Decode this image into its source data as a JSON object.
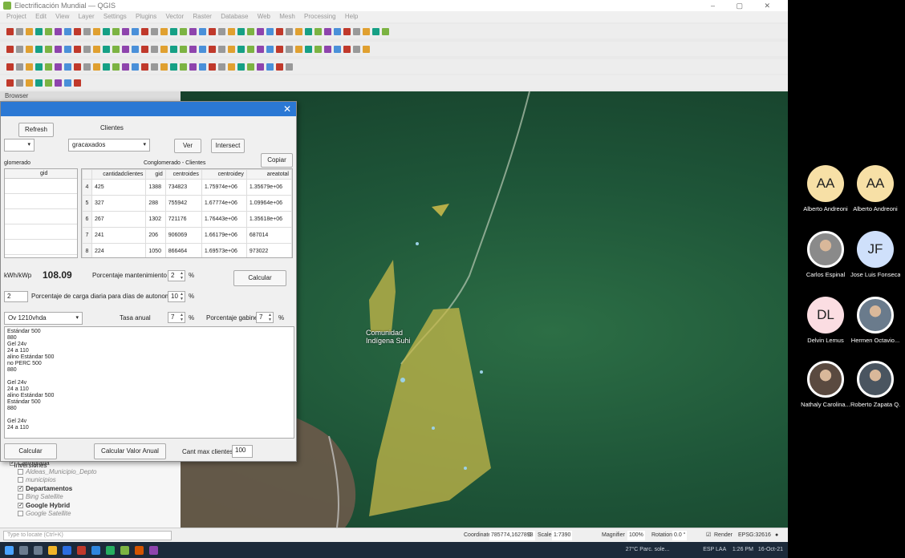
{
  "window": {
    "title": "Electrificación Mundial — QGIS"
  },
  "menu": [
    "Project",
    "Edit",
    "View",
    "Layer",
    "Settings",
    "Plugins",
    "Vector",
    "Raster",
    "Database",
    "Web",
    "Mesh",
    "Processing",
    "Help"
  ],
  "panels": {
    "browser": "Browser"
  },
  "dialog": {
    "refresh_label": "Refresh",
    "clientes_label": "Clientes",
    "combo_left_value": "",
    "combo_clientes_value": "gracaxados",
    "ver_label": "Ver",
    "intersect_label": "Intersect",
    "copiar_label": "Copiar",
    "conglomerado_label": "glomerado",
    "conglomerado_clientes_label": "Conglomerado - Clientes",
    "left_grid_header": "gid",
    "table_headers": [
      "cantidadclientes",
      "gid",
      "centroides",
      "centroidey",
      "areatotal"
    ],
    "table_rows": [
      {
        "n": "4",
        "c": "425",
        "gid": "1388",
        "cx": "734823",
        "cy": "1.75974e+06",
        "a": "1.35679e+06"
      },
      {
        "n": "5",
        "c": "327",
        "gid": "288",
        "cx": "755942",
        "cy": "1.67774e+06",
        "a": "1.09964e+06"
      },
      {
        "n": "6",
        "c": "267",
        "gid": "1302",
        "cx": "721176",
        "cy": "1.76443e+06",
        "a": "1.35618e+06"
      },
      {
        "n": "7",
        "c": "241",
        "gid": "206",
        "cx": "906069",
        "cy": "1.66179e+06",
        "a": "687014"
      },
      {
        "n": "8",
        "c": "224",
        "gid": "1050",
        "cx": "866464",
        "cy": "1.69573e+06",
        "a": "973022"
      }
    ],
    "kwh_label": "kWh/kWp",
    "kwh_value": "108.09",
    "mant_label": "Porcentaje mantenimiento",
    "mant_value": "2",
    "pct": "%",
    "calcular_label": "Calcular",
    "carga_input": "2",
    "carga_label": "Porcentaje de carga diaria para días de autonomía",
    "carga_value": "10",
    "bateria_combo": "Ov 1210vhda",
    "tasa_label": "Tasa anual",
    "tasa_value": "7",
    "gabinete_label": "Porcentaje gabinete",
    "gabinete_value": "7",
    "output_lines": [
      "Estándar 500",
      "880",
      "Gel 24v",
      "24 a 110",
      "alino Estándar 500",
      "no PERC 500",
      "880",
      "",
      "Gel 24v",
      "24 a 110",
      "alino Estándar 500",
      "Estándar 500",
      "880",
      "",
      "Gel 24v",
      "24 a 110"
    ],
    "calc_inversiones": "Calcular Inversiones",
    "calc_valor_anual": "Calcular Valor Anual",
    "cant_max_label": "Cant max clientes",
    "cant_max_value": "100"
  },
  "layers": [
    {
      "label": "Cartografia",
      "checked": true,
      "bold": false
    },
    {
      "label": "Aldeas_Municipio_Depto",
      "checked": false,
      "bold": false
    },
    {
      "label": "municipios",
      "checked": false,
      "bold": false
    },
    {
      "label": "Departamentos",
      "checked": true,
      "bold": true
    },
    {
      "label": "Bing Satellite",
      "checked": false,
      "bold": false
    },
    {
      "label": "Google Hybrid",
      "checked": true,
      "bold": true
    },
    {
      "label": "Google Satellite",
      "checked": false,
      "bold": false
    }
  ],
  "map": {
    "place_label": "Comunidad Indígena Suhi"
  },
  "status": {
    "search_placeholder": "Type to locate (Ctrl+K)",
    "coordinate_label": "Coordinate",
    "coordinate_value": "785774,1627898",
    "scale_label": "Scale",
    "scale_value": "1:7390",
    "magnifier_label": "Magnifier",
    "magnifier_value": "100%",
    "rotation_label": "Rotation",
    "rotation_value": "0.0 °",
    "render_label": "Render",
    "crs": "EPSG:32616"
  },
  "taskbar": {
    "weather": "27°C Parc. sole...",
    "lang": "ESP LAA",
    "time": "1:26 PM",
    "date": "16-Oct-21"
  },
  "participants": [
    {
      "initials": "AA",
      "name": "Alberto Andreoni",
      "color": "#f7e0a6",
      "photo": false
    },
    {
      "initials": "AA",
      "name": "Alberto Andreoni",
      "color": "#f7e0a6",
      "photo": false
    },
    {
      "initials": "",
      "name": "Carlos Espinal",
      "color": "#8a8a8a",
      "photo": true
    },
    {
      "initials": "JF",
      "name": "Jose Luis Fonseca...",
      "color": "#cfe0fb",
      "photo": false
    },
    {
      "initials": "DL",
      "name": "Delvin Lemus",
      "color": "#fbdde2",
      "photo": false
    },
    {
      "initials": "",
      "name": "Hermen Octavio...",
      "color": "#6a7b8c",
      "photo": true
    },
    {
      "initials": "",
      "name": "Nathaly Carolina...",
      "color": "#5a4a40",
      "photo": true
    },
    {
      "initials": "",
      "name": "Roberto Zapata Q...",
      "color": "#4a5560",
      "photo": true
    }
  ]
}
